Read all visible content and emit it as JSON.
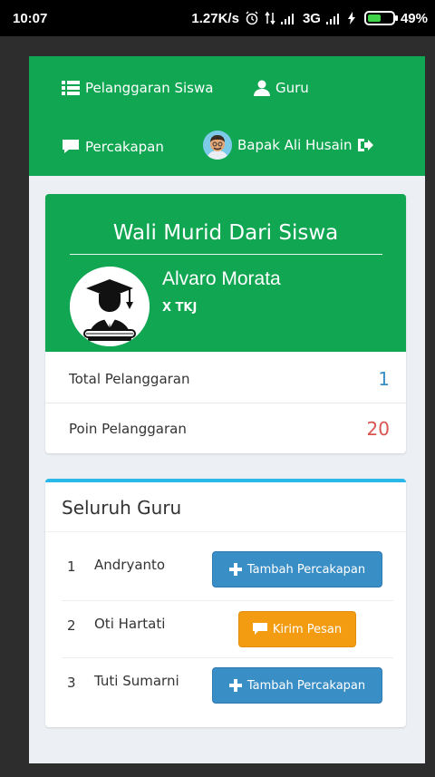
{
  "status_bar": {
    "time": "10:07",
    "speed": "1.27K/s",
    "network": "3G",
    "battery": "49%"
  },
  "nav": {
    "item1": "Pelanggaran Siswa",
    "item2": "Guru",
    "item3": "Percakapan",
    "user": "Bapak Ali Husain"
  },
  "profile": {
    "title": "Wali Murid Dari Siswa",
    "student_name": "Alvaro Morata",
    "student_class": "X TKJ",
    "stats": [
      {
        "label": "Total Pelanggaran",
        "value": "1",
        "color": "#3a8ec6"
      },
      {
        "label": "Poin Pelanggaran",
        "value": "20",
        "color": "#d9534f"
      }
    ]
  },
  "teachers": {
    "title": "Seluruh Guru",
    "rows": [
      {
        "num": "1",
        "name": "Andryanto",
        "action": "Tambah Percakapan"
      },
      {
        "num": "2",
        "name": "Oti Hartati",
        "action": "Kirim Pesan"
      },
      {
        "num": "3",
        "name": "Tuti Sumarni",
        "action": "Tambah Percakapan"
      }
    ]
  },
  "colors": {
    "brand_green": "#10a652",
    "accent_blue": "#3a8ec6",
    "accent_orange": "#f39c12",
    "danger_red": "#d9534f"
  }
}
